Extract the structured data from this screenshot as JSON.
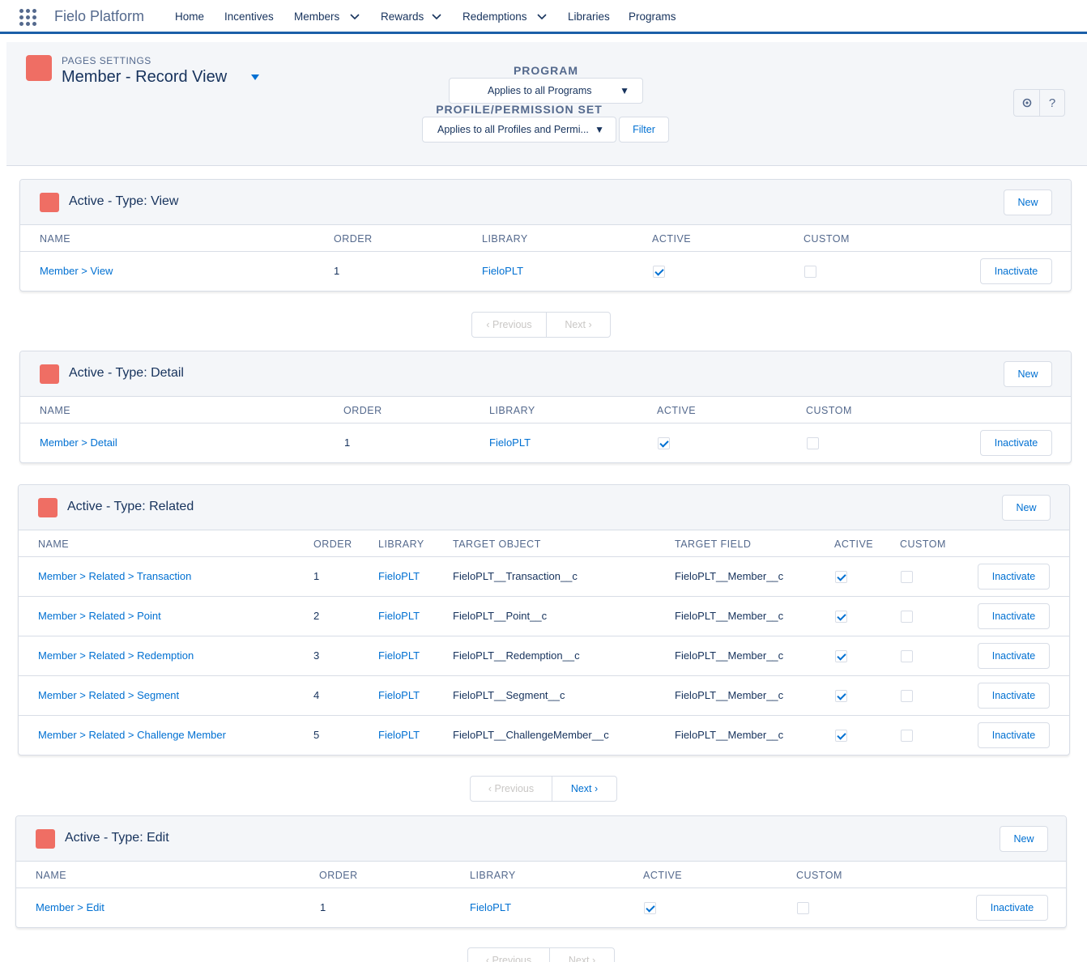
{
  "app": {
    "name": "Fielo Platform"
  },
  "nav": {
    "items": [
      {
        "label": "Home"
      },
      {
        "label": "Incentives"
      },
      {
        "label": "Members"
      },
      {
        "label": "Rewards"
      },
      {
        "label": "Redemptions"
      },
      {
        "label": "Libraries"
      },
      {
        "label": "Programs"
      }
    ]
  },
  "header": {
    "eyebrow": "PAGES SETTINGS",
    "title": "Member - Record View",
    "program_label": "PROGRAM",
    "program_value": "Applies to all Programs",
    "profile_label": "PROFILE/PERMISSION SET",
    "profile_value": "Applies to all Profiles and Permi...",
    "filter_label": "Filter",
    "help_label": "?"
  },
  "accent_color": "#ef6e64",
  "link_color": "#0070d2",
  "buttons": {
    "new": "New",
    "inactivate": "Inactivate"
  },
  "pager": {
    "previous": "Previous",
    "next": "Next"
  },
  "sections": {
    "view": {
      "title": "Active - Type: View",
      "headers": {
        "name": "NAME",
        "order": "ORDER",
        "library": "LIBRARY",
        "active": "ACTIVE",
        "custom": "CUSTOM"
      },
      "rows": [
        {
          "name": "Member > View",
          "order": "1",
          "library": "FieloPLT",
          "active": true,
          "custom": false
        }
      ]
    },
    "detail": {
      "title": "Active - Type: Detail",
      "headers": {
        "name": "NAME",
        "order": "ORDER",
        "library": "LIBRARY",
        "active": "ACTIVE",
        "custom": "CUSTOM"
      },
      "rows": [
        {
          "name": "Member > Detail",
          "order": "1",
          "library": "FieloPLT",
          "active": true,
          "custom": false
        }
      ]
    },
    "related": {
      "title": "Active - Type: Related",
      "headers": {
        "name": "NAME",
        "order": "ORDER",
        "library": "LIBRARY",
        "target_object": "TARGET OBJECT",
        "target_field": "TARGET FIELD",
        "active": "ACTIVE",
        "custom": "CUSTOM"
      },
      "rows": [
        {
          "name": "Member > Related > Transaction",
          "order": "1",
          "library": "FieloPLT",
          "target_object": "FieloPLT__Transaction__c",
          "target_field": "FieloPLT__Member__c",
          "active": true,
          "custom": false
        },
        {
          "name": "Member > Related > Point",
          "order": "2",
          "library": "FieloPLT",
          "target_object": "FieloPLT__Point__c",
          "target_field": "FieloPLT__Member__c",
          "active": true,
          "custom": false
        },
        {
          "name": "Member > Related > Redemption",
          "order": "3",
          "library": "FieloPLT",
          "target_object": "FieloPLT__Redemption__c",
          "target_field": "FieloPLT__Member__c",
          "active": true,
          "custom": false
        },
        {
          "name": "Member > Related > Segment",
          "order": "4",
          "library": "FieloPLT",
          "target_object": "FieloPLT__Segment__c",
          "target_field": "FieloPLT__Member__c",
          "active": true,
          "custom": false
        },
        {
          "name": "Member > Related > Challenge Member",
          "order": "5",
          "library": "FieloPLT",
          "target_object": "FieloPLT__ChallengeMember__c",
          "target_field": "FieloPLT__Member__c",
          "active": true,
          "custom": false
        }
      ]
    },
    "edit": {
      "title": "Active - Type: Edit",
      "headers": {
        "name": "NAME",
        "order": "ORDER",
        "library": "LIBRARY",
        "active": "ACTIVE",
        "custom": "CUSTOM"
      },
      "rows": [
        {
          "name": "Member > Edit",
          "order": "1",
          "library": "FieloPLT",
          "active": true,
          "custom": false
        }
      ]
    }
  }
}
